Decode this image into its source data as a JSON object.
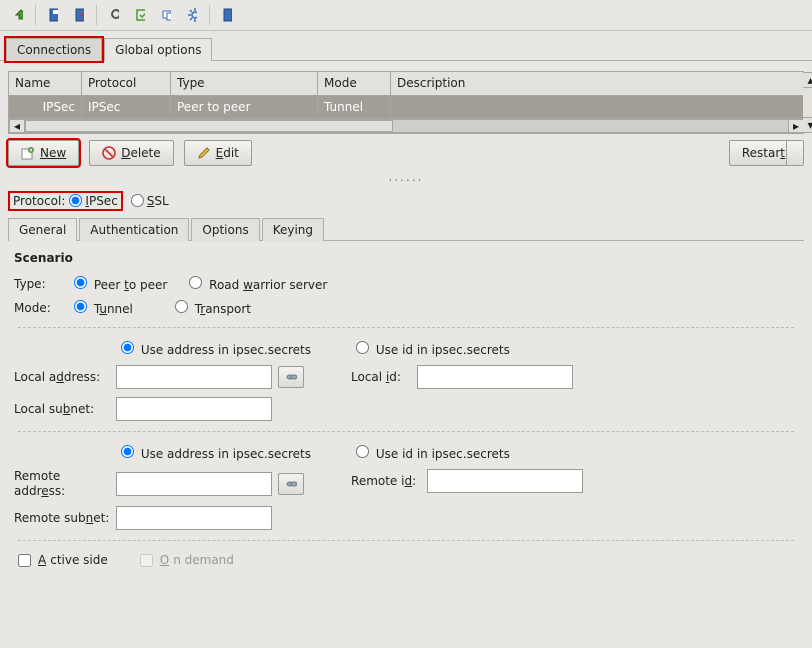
{
  "tabs_primary": {
    "connections": "Connections",
    "global": "Global options"
  },
  "table": {
    "headers": {
      "name": "Name",
      "protocol": "Protocol",
      "type": "Type",
      "mode": "Mode",
      "description": "Description"
    },
    "row": {
      "name": "IPSec",
      "protocol": "IPSec",
      "type": "Peer to peer",
      "mode": "Tunnel",
      "description": ""
    }
  },
  "buttons": {
    "new_": "New",
    "delete_": "Delete",
    "edit": "Edit",
    "restart": "Restart"
  },
  "protocol": {
    "label": "Protocol:",
    "ipsec": "IPSec",
    "ssl": "SSL"
  },
  "subtabs": {
    "general": "General",
    "auth": "Authentication",
    "options": "Options",
    "keying": "Keying"
  },
  "scenario": {
    "header": "Scenario",
    "type_label": "Type:",
    "peer_to_peer": "Peer to peer",
    "road_warrior": "Road warrior server",
    "mode_label": "Mode:",
    "tunnel": "Tunnel",
    "transport": "Transport",
    "use_addr": "Use address in ipsec.secrets",
    "use_id": "Use id in ipsec.secrets",
    "local_addr": "Local address:",
    "local_id": "Local id:",
    "local_subnet": "Local subnet:",
    "remote_addr": "Remote address:",
    "remote_id": "Remote id:",
    "remote_subnet": "Remote subnet:",
    "active_side": "Active side",
    "on_demand": "On demand"
  },
  "dots": "......"
}
